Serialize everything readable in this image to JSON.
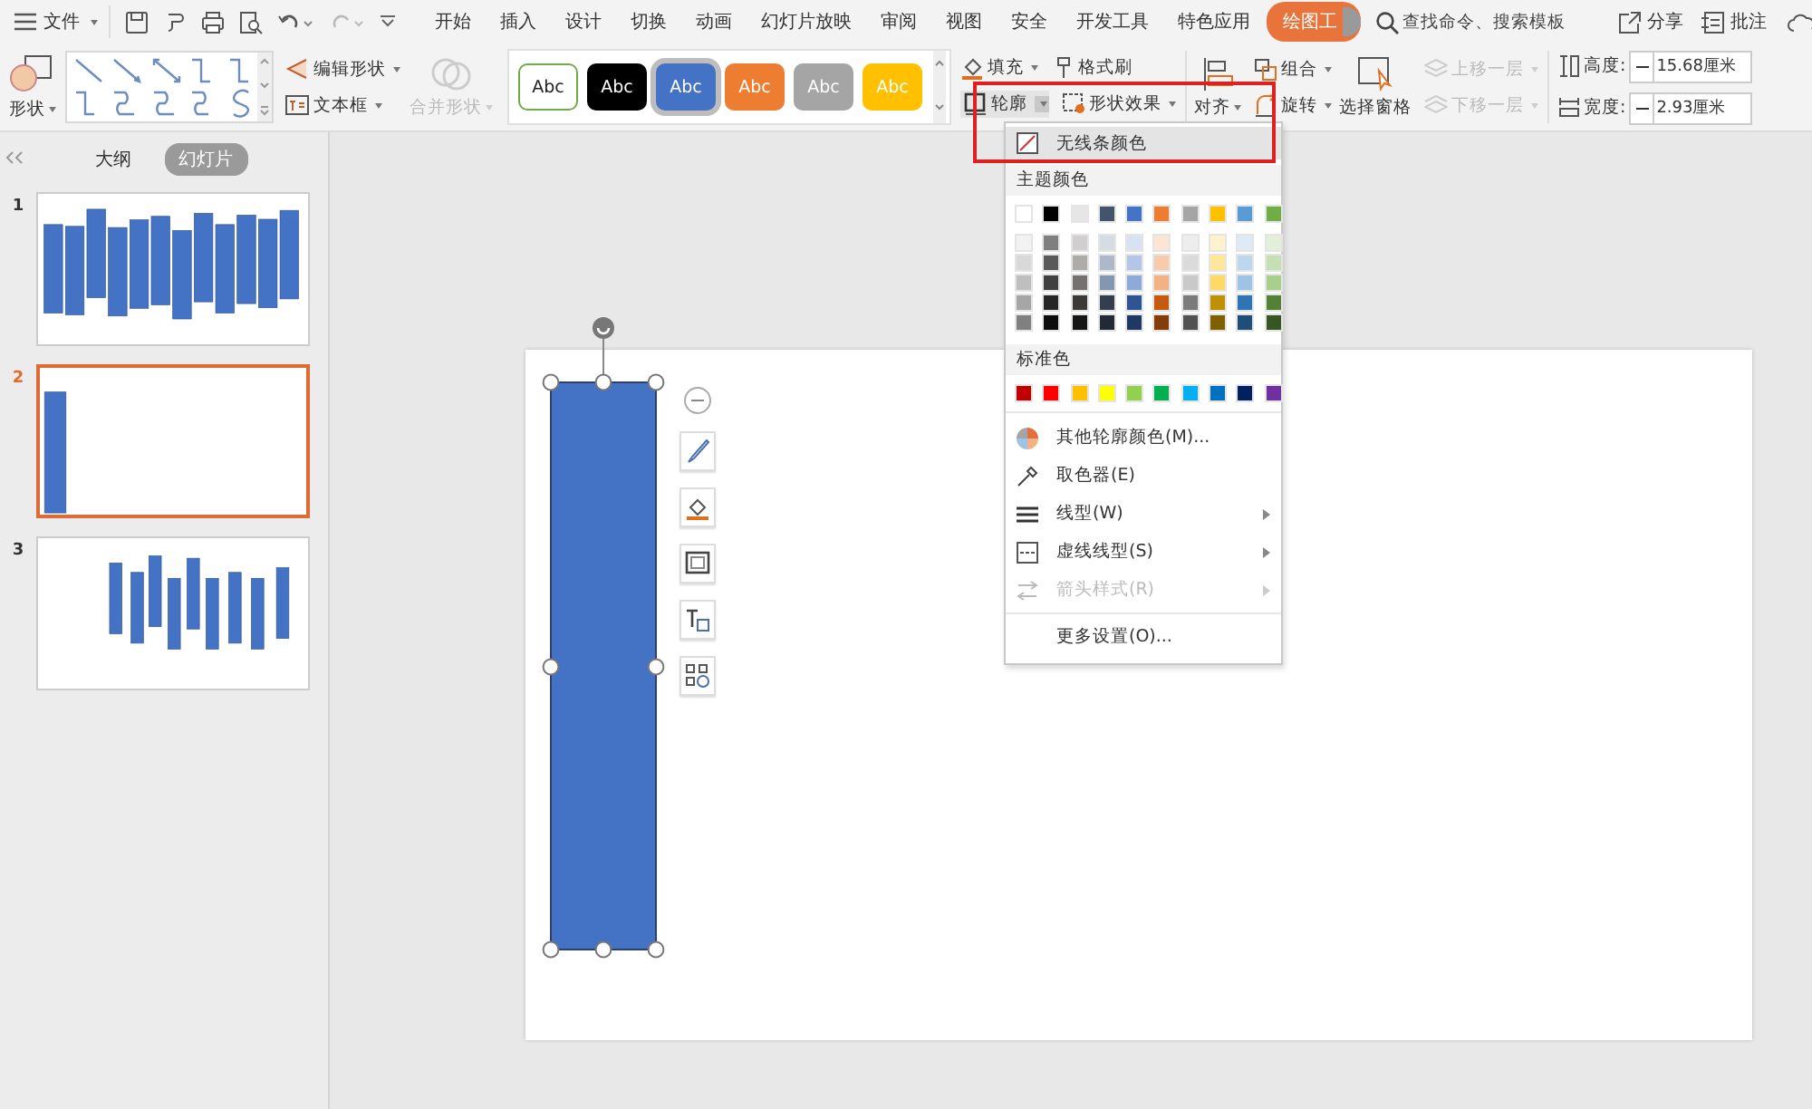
{
  "menu": {
    "file_label": "文件",
    "tabs": [
      {
        "label": "开始",
        "selected": false
      },
      {
        "label": "插入",
        "selected": false
      },
      {
        "label": "设计",
        "selected": false
      },
      {
        "label": "切换",
        "selected": false
      },
      {
        "label": "动画",
        "selected": false
      },
      {
        "label": "幻灯片放映",
        "selected": false
      },
      {
        "label": "审阅",
        "selected": false
      },
      {
        "label": "视图",
        "selected": false
      },
      {
        "label": "安全",
        "selected": false
      },
      {
        "label": "开发工具",
        "selected": false
      },
      {
        "label": "特色应用",
        "selected": false
      },
      {
        "label": "绘图工",
        "selected": true
      }
    ],
    "search": {
      "placeholder": "查找命令、搜索模板"
    },
    "share": "分享",
    "comment": "批注"
  },
  "ribbon": {
    "shape": "形状",
    "edit_shape": "编辑形状",
    "text_box": "文本框",
    "merge_shape": {
      "label": "合并形状",
      "disabled": true
    },
    "styles": [
      {
        "label": "Abc",
        "kind": "outline",
        "color": "#70ad47",
        "selected": false
      },
      {
        "label": "Abc",
        "kind": "filled",
        "color": "#000000",
        "selected": false
      },
      {
        "label": "Abc",
        "kind": "filled",
        "color": "#4472c4",
        "selected": true
      },
      {
        "label": "Abc",
        "kind": "filled",
        "color": "#ed7d31",
        "selected": false
      },
      {
        "label": "Abc",
        "kind": "filled",
        "color": "#a5a5a5",
        "selected": false
      },
      {
        "label": "Abc",
        "kind": "filled",
        "color": "#ffc000",
        "selected": false
      }
    ],
    "fill": "填充",
    "format_painter": "格式刷",
    "outline": "轮廓",
    "shape_effect": "形状效果",
    "align": "对齐",
    "group": "组合",
    "rotate": "旋转",
    "selection_pane": "选择窗格",
    "bring_forward": {
      "label": "上移一层",
      "disabled": true
    },
    "send_backward": {
      "label": "下移一层",
      "disabled": true
    },
    "height": {
      "label": "高度:",
      "value": "15.68厘米"
    },
    "width": {
      "label": "宽度:",
      "value": "2.93厘米"
    }
  },
  "sidebar": {
    "tabs": [
      {
        "label": "大纲",
        "selected": false
      },
      {
        "label": "幻灯片",
        "selected": true
      }
    ],
    "slides": [
      {
        "number": "1",
        "selected": false
      },
      {
        "number": "2",
        "selected": true
      },
      {
        "number": "3",
        "selected": false
      }
    ]
  },
  "outline_menu": {
    "no_line": "无线条颜色",
    "theme_title": "主题颜色",
    "theme_colors": [
      {
        "color": "#ffffff",
        "shades": [
          {
            "color": "#f2f2f2"
          },
          {
            "color": "#d9d9d9"
          },
          {
            "color": "#bfbfbf"
          },
          {
            "color": "#a6a6a6"
          },
          {
            "color": "#808080"
          }
        ]
      },
      {
        "color": "#000000",
        "shades": [
          {
            "color": "#7f7f7f"
          },
          {
            "color": "#595959"
          },
          {
            "color": "#404040"
          },
          {
            "color": "#262626"
          },
          {
            "color": "#0d0d0d"
          }
        ]
      },
      {
        "color": "#e7e6e6",
        "shades": [
          {
            "color": "#d0cece"
          },
          {
            "color": "#aeabab"
          },
          {
            "color": "#767171"
          },
          {
            "color": "#3b3838"
          },
          {
            "color": "#171616"
          }
        ]
      },
      {
        "color": "#44546a",
        "shades": [
          {
            "color": "#d6dce4"
          },
          {
            "color": "#adb9ca"
          },
          {
            "color": "#8497b0"
          },
          {
            "color": "#333f4f"
          },
          {
            "color": "#222a35"
          }
        ]
      },
      {
        "color": "#4472c4",
        "shades": [
          {
            "color": "#d9e2f3"
          },
          {
            "color": "#b4c6e7"
          },
          {
            "color": "#8eaadb"
          },
          {
            "color": "#2f5496"
          },
          {
            "color": "#1f3864"
          }
        ]
      },
      {
        "color": "#ed7d31",
        "shades": [
          {
            "color": "#fbe5d5"
          },
          {
            "color": "#f7cbac"
          },
          {
            "color": "#f4b183"
          },
          {
            "color": "#c55a11"
          },
          {
            "color": "#843c0b"
          }
        ]
      },
      {
        "color": "#a5a5a5",
        "shades": [
          {
            "color": "#ededed"
          },
          {
            "color": "#dbdbdb"
          },
          {
            "color": "#c9c9c9"
          },
          {
            "color": "#7b7b7b"
          },
          {
            "color": "#525252"
          }
        ]
      },
      {
        "color": "#ffc000",
        "shades": [
          {
            "color": "#fff2cc"
          },
          {
            "color": "#ffe699"
          },
          {
            "color": "#ffd966"
          },
          {
            "color": "#bf9000"
          },
          {
            "color": "#7f6000"
          }
        ]
      },
      {
        "color": "#5b9bd5",
        "shades": [
          {
            "color": "#deebf6"
          },
          {
            "color": "#bdd7ee"
          },
          {
            "color": "#9dc3e6"
          },
          {
            "color": "#2e75b5"
          },
          {
            "color": "#1f4e79"
          }
        ]
      },
      {
        "color": "#70ad47",
        "shades": [
          {
            "color": "#e2efd9"
          },
          {
            "color": "#c5e0b3"
          },
          {
            "color": "#a8d08d"
          },
          {
            "color": "#538135"
          },
          {
            "color": "#375623"
          }
        ]
      }
    ],
    "standard_title": "标准色",
    "standard_colors": [
      {
        "color": "#c00000"
      },
      {
        "color": "#ff0000"
      },
      {
        "color": "#ffc000"
      },
      {
        "color": "#ffff00"
      },
      {
        "color": "#92d050"
      },
      {
        "color": "#00b050"
      },
      {
        "color": "#00b0f0"
      },
      {
        "color": "#0070c0"
      },
      {
        "color": "#002060"
      },
      {
        "color": "#7030a0"
      }
    ],
    "items": [
      {
        "label": "其他轮廓颜色(M)...",
        "kind": "palette",
        "submenu": false,
        "disabled": false
      },
      {
        "label": "取色器(E)",
        "kind": "eyedropper",
        "submenu": false,
        "disabled": false
      },
      {
        "label": "线型(W)",
        "kind": "weight",
        "submenu": true,
        "disabled": false
      },
      {
        "label": "虚线线型(S)",
        "kind": "dash",
        "submenu": true,
        "disabled": false
      },
      {
        "label": "箭头样式(R)",
        "kind": "arrow",
        "submenu": true,
        "disabled": true
      },
      {
        "label": "更多设置(O)...",
        "kind": "more",
        "submenu": false,
        "disabled": false
      }
    ]
  }
}
